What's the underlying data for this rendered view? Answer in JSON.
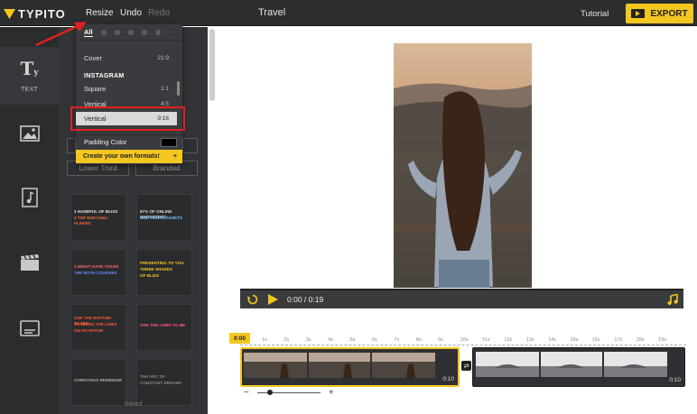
{
  "app": {
    "logo_text": "TYPITO",
    "project_title": "Travel"
  },
  "menu": {
    "resize": "Resize",
    "undo": "Undo",
    "redo": "Redo"
  },
  "header": {
    "tutorial": "Tutorial",
    "export": "EXPORT"
  },
  "rail": {
    "text_label": "TEXT"
  },
  "resize_dropdown": {
    "tab_all": "All",
    "rows": {
      "cover": {
        "label": "Cover",
        "ratio": "21:9"
      },
      "section": "INSTAGRAM",
      "square": {
        "label": "Square",
        "ratio": "1:1"
      },
      "vertical_45": {
        "label": "Vertical",
        "ratio": "4:5"
      },
      "vertical_916": {
        "label": "Vertical",
        "ratio": "9:16"
      }
    },
    "padding_color_label": "Padding Color",
    "padding_color": "#000000",
    "create_formats": "Create your own formats!",
    "create_plus": "+"
  },
  "panel": {
    "lower_third": "Lower Third",
    "branded": "Branded",
    "saved": "Saved",
    "templates": [
      {
        "lines": [
          "1 HANDFUL OF BLISS",
          "2 TSP SUN CHILI FLAKES"
        ],
        "colors": [
          "#e9e9e9",
          "#ff6a3c"
        ]
      },
      {
        "lines": [
          "87% OF ONLINE MARKETERS",
          "USE VISUAL ASSETS"
        ],
        "colors": [
          "#d7d7d7",
          "#6bc2ff"
        ]
      },
      {
        "lines": [
          "1 MIGHT HAVE TAKEN",
          "THE BOTH COURSES"
        ],
        "colors": [
          "#ff6666",
          "#6b8cff"
        ]
      },
      {
        "lines": [
          "PRESENTING TO YOU",
          "THREE SHADES",
          "OF BLISS"
        ],
        "colors": [
          "#f3c620",
          "#f3c620",
          "#f3c620"
        ]
      },
      {
        "lines": [
          "USE THE RHYTHM BASED",
          "TO BRING THE LINES",
          "ON AN AFFAIR"
        ],
        "colors": [
          "#ff5a36",
          "#ff5a36",
          "#ff5a36"
        ]
      },
      {
        "lines": [
          "ARE THE LINES TO BE"
        ],
        "colors": [
          "#ff5a7a"
        ]
      },
      {
        "lines": [
          "CHRISTMAS REMINDER"
        ],
        "colors": [
          "#aaaaaa"
        ]
      },
      {
        "lines": [
          "THE ARC OF",
          "CONSTANT DREAMS"
        ],
        "colors": [
          "#888888",
          "#888888"
        ]
      }
    ]
  },
  "player": {
    "current_time": "0:00",
    "separator": "/",
    "duration": "0:19"
  },
  "timeline": {
    "playhead": "0:00",
    "ticks": [
      "1s",
      "2s",
      "3s",
      "4s",
      "5s",
      "6s",
      "7s",
      "8s",
      "9s",
      "10s",
      "11s",
      "12s",
      "13s",
      "14s",
      "15s",
      "16s",
      "17s",
      "18s",
      "19s"
    ],
    "clips": [
      {
        "duration": "0:10"
      },
      {
        "duration": "0:10"
      }
    ],
    "zoom_minus": "−",
    "zoom_plus": "+",
    "zoom_level": 0.2
  },
  "colors": {
    "accent": "#f3c620",
    "annotation": "#e02020",
    "dark": "#2c2d2f"
  }
}
